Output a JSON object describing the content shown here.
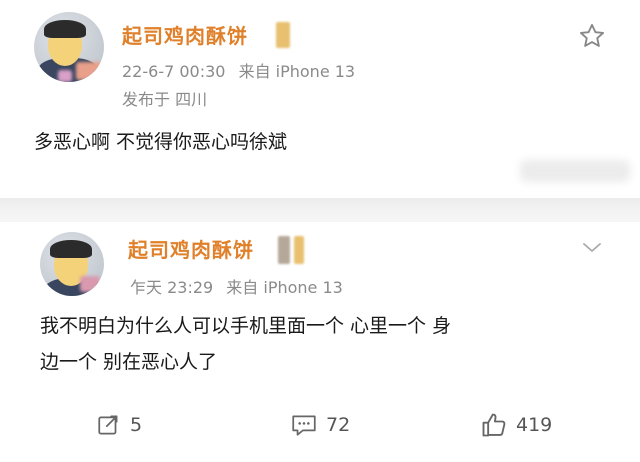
{
  "posts": [
    {
      "username": "起司鸡肉酥饼",
      "timestamp": "22-6-7 00:30",
      "device": "来自 iPhone 13",
      "location": "发布于 四川",
      "content_lines": [
        "多恶心啊 不觉得你恶心吗徐斌"
      ]
    },
    {
      "username": "起司鸡肉酥饼",
      "timestamp": "乍天 23:29",
      "device": "来自 iPhone 13",
      "content_lines": [
        "我不明白为什么人可以手机里面一个 心里一个 身",
        "边一个 别在恶心人了"
      ]
    }
  ],
  "actions": {
    "repost_count": "5",
    "comment_count": "72",
    "like_count": "419"
  },
  "icons": {
    "favorite": "star-icon",
    "more": "chevron-down-icon",
    "repost": "repost-icon",
    "comment": "comment-icon",
    "like": "thumbs-up-icon"
  },
  "colors": {
    "username": "#e0802a",
    "meta": "#8a8a8a",
    "separator": "#f2f2f2"
  }
}
